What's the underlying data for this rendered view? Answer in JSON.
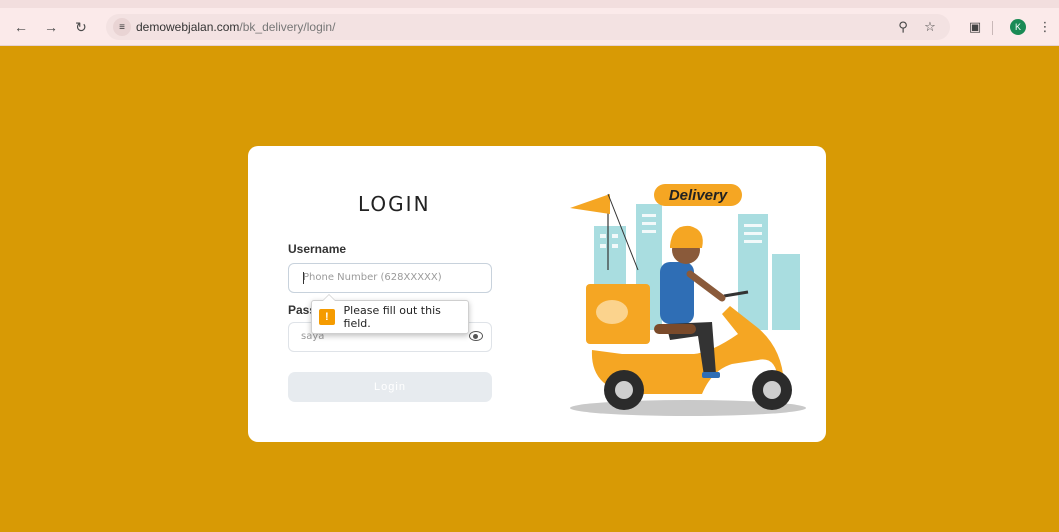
{
  "browser": {
    "url_main": "demowebjalan.com",
    "url_path": "/bk_delivery/login/",
    "back_icon": "arrow-left-icon",
    "forward_icon": "arrow-right-icon",
    "reload_icon": "reload-icon",
    "site_info_icon": "tune-icon",
    "key_icon": "key-icon",
    "star_icon": "star-icon",
    "extensions_icon": "puzzle-icon",
    "menu_icon": "kebab-menu-icon",
    "profile_initial": "K"
  },
  "colors": {
    "page_background": "#d89a05",
    "card_background": "#ffffff",
    "button_disabled": "#e7ebef",
    "warning": "#f59b00"
  },
  "login": {
    "title": "LOGIN",
    "username_label": "Username",
    "username_placeholder": "Phone Number (628XXXXX)",
    "password_label": "Password",
    "password_value": "saya",
    "login_button": "Login",
    "validation_message": "Please fill out this field."
  },
  "illustration": {
    "badge_text": "Delivery"
  }
}
